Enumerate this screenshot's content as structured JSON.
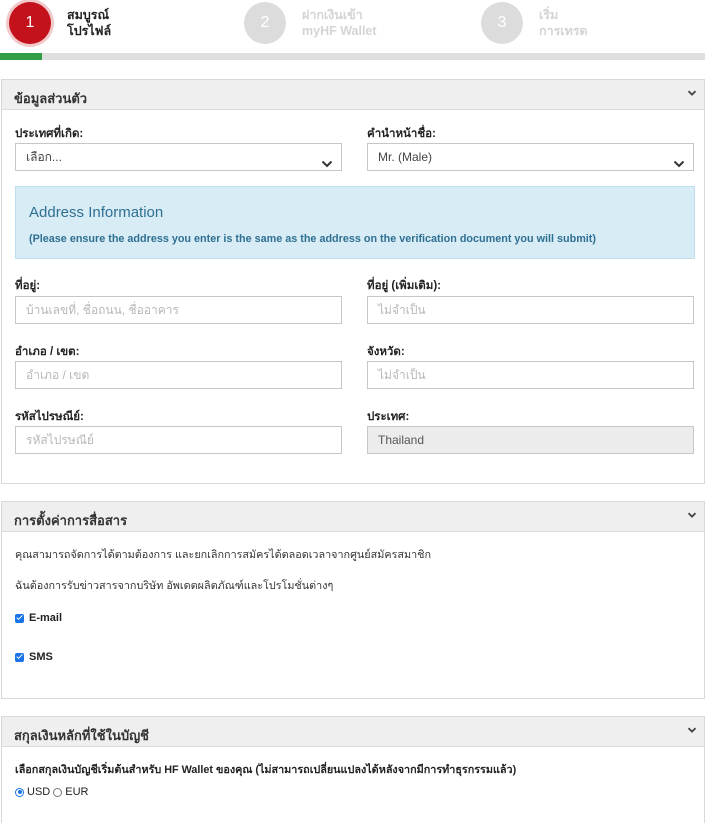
{
  "stepper": {
    "steps": [
      {
        "number": "1",
        "line1": "สมบูรณ์",
        "line2": "โปรไฟล์",
        "active": true
      },
      {
        "number": "2",
        "line1": "ฝากเงินเข้า",
        "line2": "myHF Wallet",
        "active": false
      },
      {
        "number": "3",
        "line1": "เริ่ม",
        "line2": "การเทรด",
        "active": false
      }
    ],
    "progress_percent": 6,
    "colors": {
      "active": "#c3121c",
      "inactive": "#dcdcdc",
      "progress": "#2f9e44"
    }
  },
  "personal": {
    "title": "ข้อมูลส่วนตัว",
    "birth_country_label": "ประเทศที่เกิด:",
    "birth_country_value": "เลือก...",
    "prefix_label": "คำนำหน้าชื่อ:",
    "prefix_value": "Mr. (Male)",
    "address_info": {
      "heading": "Address Information",
      "note": "(Please ensure the address you enter is the same as the address on the verification document you will submit)"
    },
    "address_label": "ที่อยู่:",
    "address_placeholder": "บ้านเลขที่, ชื่อถนน, ชื่ออาคาร",
    "address2_label": "ที่อยู่ (เพิ่มเติม):",
    "address2_placeholder": "ไม่จำเป็น",
    "district_label": "อำเภอ / เขต:",
    "district_placeholder": "อำเภอ / เขต",
    "province_label": "จังหวัด:",
    "province_placeholder": "ไม่จำเป็น",
    "postal_label": "รหัสไปรษณีย์:",
    "postal_placeholder": "รหัสไปรษณีย์",
    "country_label": "ประเทศ:",
    "country_value": "Thailand"
  },
  "communication": {
    "title": "การตั้งค่าการสื่อสาร",
    "text1": "คุณสามารถจัดการได้ตามต้องการ และยกเลิกการสมัครได้ตลอดเวลาจากศูนย์สมัครสมาชิก",
    "text2": "ฉันต้องการรับข่าวสารจากบริษัท อัพเดตผลิตภัณฑ์และโปรโมชั่นต่างๆ",
    "email_label": "E-mail",
    "email_checked": true,
    "sms_label": "SMS",
    "sms_checked": true
  },
  "currency": {
    "title": "สกุลเงินหลักที่ใช้ในบัญชี",
    "description": "เลือกสกุลเงินบัญชีเริ่มต้นสำหรับ HF Wallet ของคุณ (ไม่สามารถเปลี่ยนแปลงได้หลังจากมีการทำธุรกรรมแล้ว)",
    "options": [
      "USD",
      "EUR"
    ],
    "selected": "USD"
  },
  "icons": {
    "panel_toggle": "chevron-down-icon",
    "select_caret": "chevron-down-icon",
    "checkbox": "checkbox-checked-icon"
  }
}
